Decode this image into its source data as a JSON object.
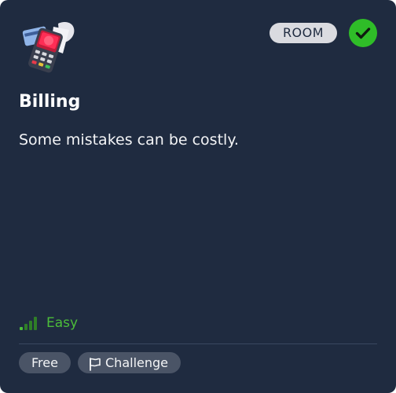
{
  "card": {
    "badge": "ROOM",
    "completed_icon": "check-circle-icon",
    "room_icon": "payment-terminal-icon",
    "title": "Billing",
    "description": "Some mistakes can be costly.",
    "difficulty": {
      "label": "Easy",
      "icon": "signal-bars-icon",
      "level": 1,
      "max_level": 4
    },
    "tags": [
      {
        "label": "Free"
      },
      {
        "label": "Challenge",
        "icon": "flag-icon"
      }
    ]
  },
  "colors": {
    "card_background": "#1f2b40",
    "badge_background": "#dadbe0",
    "success_green": "#2fbd28",
    "difficulty_green": "#4cbd3a",
    "tag_background": "#4a5466",
    "divider": "#3a4760"
  }
}
